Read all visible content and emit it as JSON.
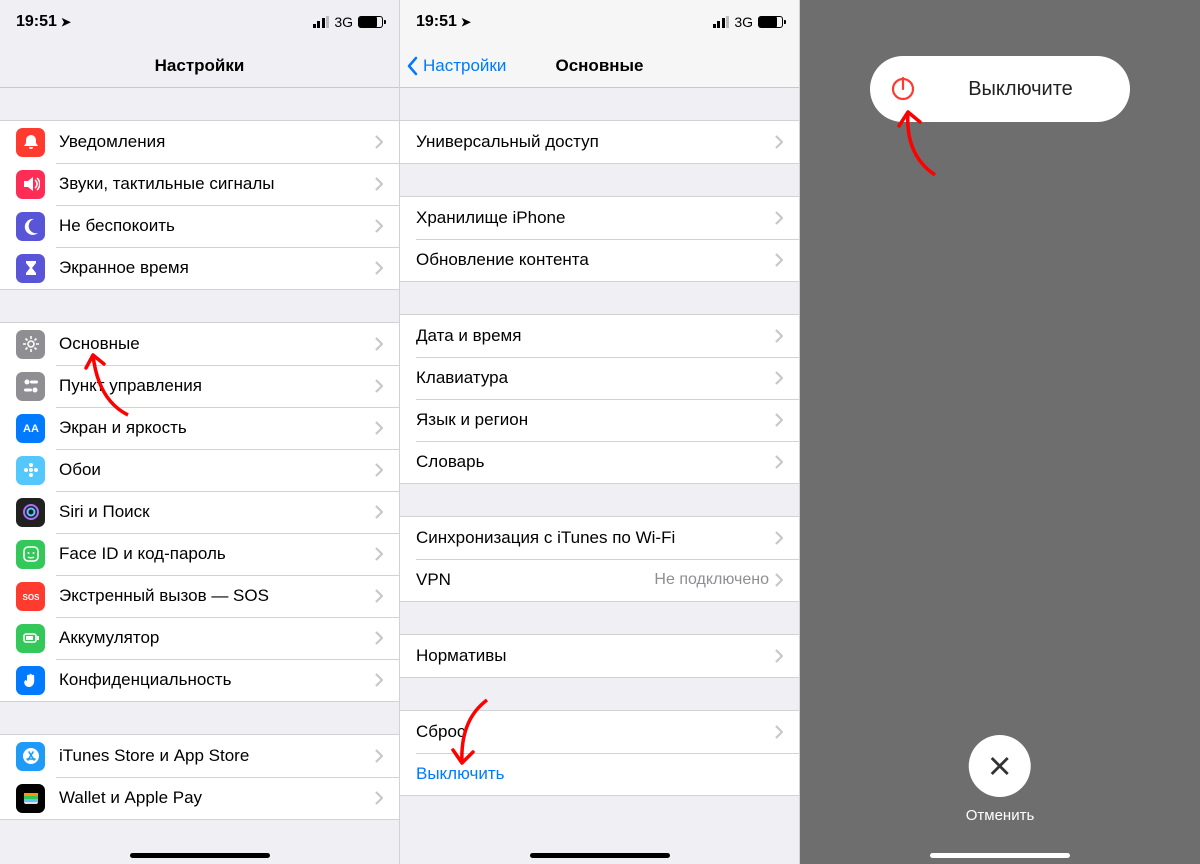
{
  "status": {
    "time": "19:51",
    "net": "3G"
  },
  "screen1": {
    "title": "Настройки",
    "g1": [
      {
        "label": "Уведомления",
        "color": "#ff3b30",
        "icon": "bell"
      },
      {
        "label": "Звуки, тактильные сигналы",
        "color": "#ff2d55",
        "icon": "sound"
      },
      {
        "label": "Не беспокоить",
        "color": "#5856d6",
        "icon": "moon"
      },
      {
        "label": "Экранное время",
        "color": "#5856d6",
        "icon": "hourglass"
      }
    ],
    "g2": [
      {
        "label": "Основные",
        "color": "#8e8e93",
        "icon": "gear"
      },
      {
        "label": "Пункт управления",
        "color": "#8e8e93",
        "icon": "switches"
      },
      {
        "label": "Экран и яркость",
        "color": "#007aff",
        "icon": "aa"
      },
      {
        "label": "Обои",
        "color": "#54c7fc",
        "icon": "flower"
      },
      {
        "label": "Siri и Поиск",
        "color": "#212121",
        "icon": "siri"
      },
      {
        "label": "Face ID и код-пароль",
        "color": "#34c759",
        "icon": "face"
      },
      {
        "label": "Экстренный вызов — SOS",
        "color": "#ff3b30",
        "icon": "sos"
      },
      {
        "label": "Аккумулятор",
        "color": "#34c759",
        "icon": "battery"
      },
      {
        "label": "Конфиденциальность",
        "color": "#007aff",
        "icon": "hand"
      }
    ],
    "g3": [
      {
        "label": "iTunes Store и App Store",
        "color": "#1d9bf6",
        "icon": "appstore"
      },
      {
        "label": "Wallet и Apple Pay",
        "color": "#000000",
        "icon": "wallet"
      }
    ]
  },
  "screen2": {
    "back": "Настройки",
    "title": "Основные",
    "rows0": [
      {
        "label": "Универсальный доступ"
      }
    ],
    "rows1": [
      {
        "label": "Хранилище iPhone"
      },
      {
        "label": "Обновление контента"
      }
    ],
    "rows2": [
      {
        "label": "Дата и время"
      },
      {
        "label": "Клавиатура"
      },
      {
        "label": "Язык и регион"
      },
      {
        "label": "Словарь"
      }
    ],
    "rows3": [
      {
        "label": "Синхронизация с iTunes по Wi-Fi"
      },
      {
        "label": "VPN",
        "detail": "Не подключено"
      }
    ],
    "rows4": [
      {
        "label": "Нормативы"
      }
    ],
    "rows5": [
      {
        "label": "Сброс"
      },
      {
        "label": "Выключить",
        "link": true
      }
    ]
  },
  "screen3": {
    "slide": "Выключите",
    "cancel": "Отменить"
  },
  "colors": {
    "accent": "#007aff",
    "red": "#ff3b30"
  }
}
